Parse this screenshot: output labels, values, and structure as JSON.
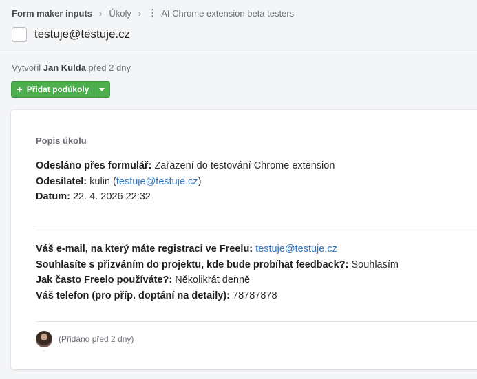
{
  "breadcrumb": {
    "item1": "Form maker inputs",
    "item2": "Úkoly",
    "item3": "AI Chrome extension beta testers"
  },
  "task": {
    "title": "testuje@testuje.cz"
  },
  "meta": {
    "prefix": "Vytvořil",
    "author": "Jan Kulda",
    "time": "před 2 dny"
  },
  "subtasks_button": {
    "label": "Přidat podúkoly"
  },
  "card": {
    "heading": "Popis úkolu",
    "form": {
      "sent_label": "Odesláno přes formulář:",
      "sent_value": "Zařazení do testování Chrome extension",
      "sender_label": "Odesílatel:",
      "sender_name": "kulin (",
      "sender_email": "testuje@testuje.cz",
      "sender_close": ")",
      "date_label": "Datum:",
      "date_value": "22. 4. 2026 22:32"
    },
    "answers": {
      "q1": "Váš e-mail, na který máte registraci ve Freelu:",
      "a1": "testuje@testuje.cz",
      "q2": "Souhlasíte s přizváním do projektu, kde bude probíhat feedback?:",
      "a2": "Souhlasím",
      "q3": "Jak často Freelo používáte?:",
      "a3": "Několikrát denně",
      "q4": "Váš telefon (pro příp. doptání na detaily):",
      "a4": "78787878"
    },
    "added": "(Přidáno před 2 dny)"
  }
}
